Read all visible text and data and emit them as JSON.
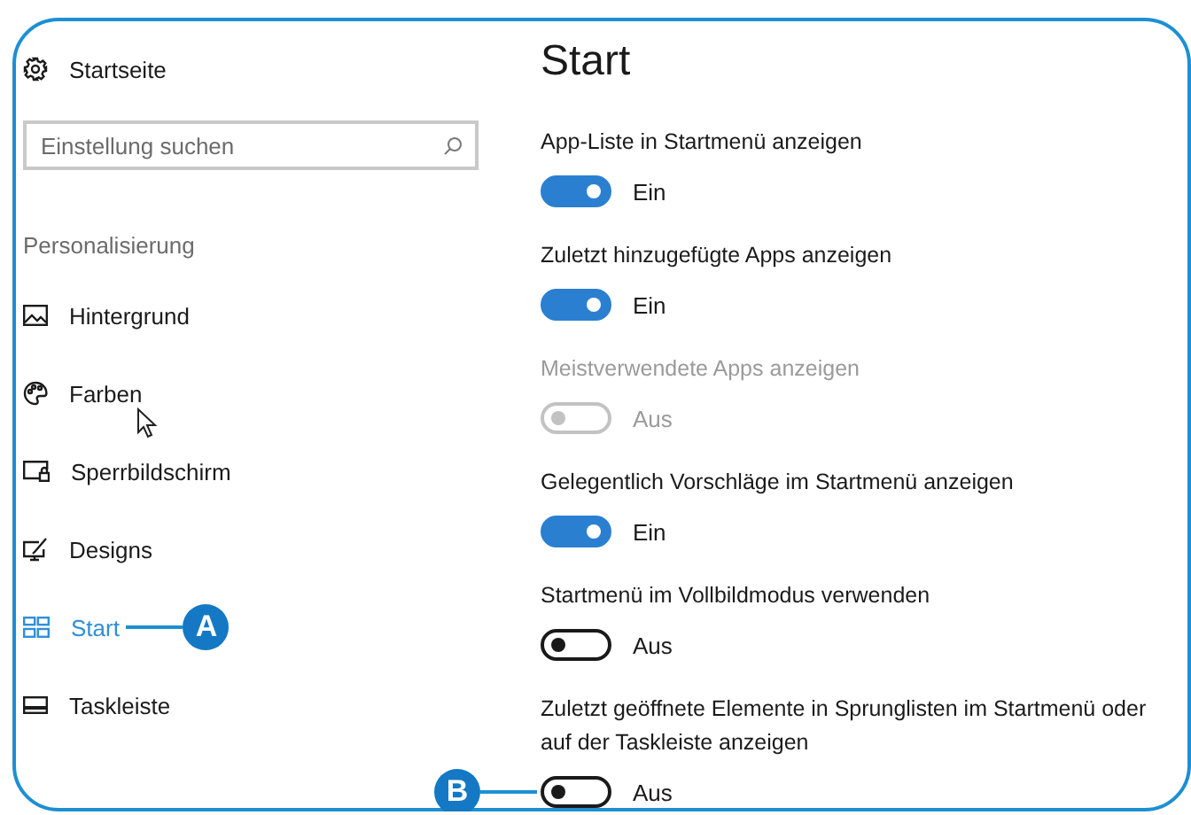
{
  "sidebar": {
    "home": {
      "label": "Startseite"
    },
    "search": {
      "placeholder": "Einstellung suchen"
    },
    "section": "Personalisierung",
    "items": [
      {
        "label": "Hintergrund",
        "selected": false
      },
      {
        "label": "Farben",
        "selected": false
      },
      {
        "label": "Sperrbildschirm",
        "selected": false
      },
      {
        "label": "Designs",
        "selected": false
      },
      {
        "label": "Start",
        "selected": true,
        "callout": "A"
      },
      {
        "label": "Taskleiste",
        "selected": false
      }
    ]
  },
  "page": {
    "title": "Start",
    "settings": [
      {
        "label": "App-Liste in Startmenü anzeigen",
        "on": true,
        "disabled": false,
        "state": "Ein"
      },
      {
        "label": "Zuletzt hinzugefügte Apps anzeigen",
        "on": true,
        "disabled": false,
        "state": "Ein"
      },
      {
        "label": "Meistverwendete Apps anzeigen",
        "on": false,
        "disabled": true,
        "state": "Aus"
      },
      {
        "label": "Gelegentlich Vorschläge im Startmenü anzeigen",
        "on": true,
        "disabled": false,
        "state": "Ein"
      },
      {
        "label": "Startmenü im Vollbildmodus verwenden",
        "on": false,
        "disabled": false,
        "state": "Aus"
      },
      {
        "label": "Zuletzt geöffnete Elemente in Sprunglisten im Startmenü oder auf der Taskleiste anzeigen",
        "on": false,
        "disabled": false,
        "state": "Aus",
        "callout": "B"
      }
    ]
  }
}
